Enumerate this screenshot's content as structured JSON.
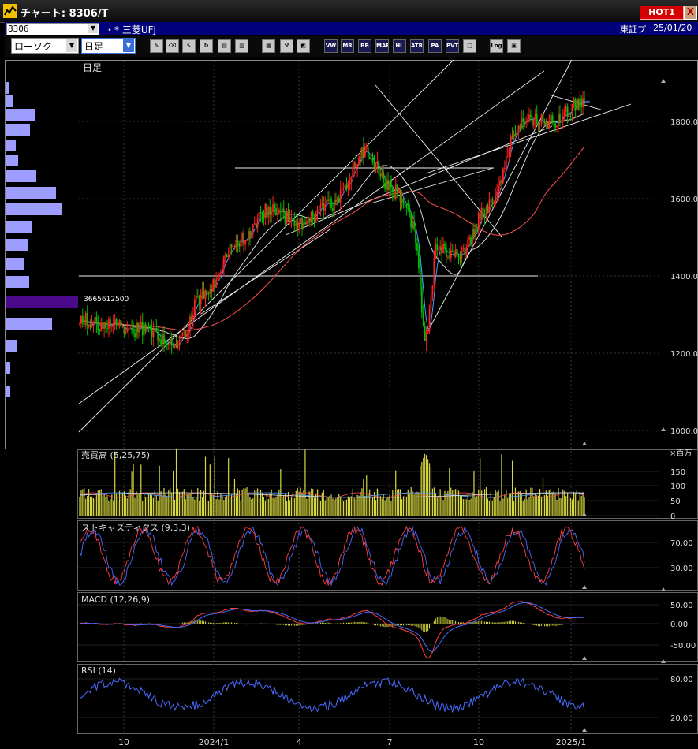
{
  "window": {
    "title": "チャート: 8306/T",
    "hot_label": "HOT1",
    "close_label": "X"
  },
  "info": {
    "code": "8306",
    "name": "・* 三菱UFJ",
    "market": "東証プ",
    "date": "25/01/20"
  },
  "toolbar": {
    "chart_type": "ローソク",
    "period": "日足"
  },
  "main_panel": {
    "label": "日足",
    "price_label_box": "3665612500",
    "y_ticks": [
      "1800.0",
      "1600.0",
      "1400.0",
      "1200.0",
      "1000.0"
    ]
  },
  "volume_panel": {
    "label": "売買高 (5,25,75)",
    "unit": "×百万",
    "y_ticks": [
      "150",
      "100",
      "50",
      "0"
    ]
  },
  "stoch_panel": {
    "label": "ストキャスティクス (9,3,3)",
    "y_ticks": [
      "70.00",
      "30.00"
    ]
  },
  "macd_panel": {
    "label": "MACD (12,26,9)",
    "y_ticks": [
      "50.00",
      "0.00",
      "-50.00"
    ]
  },
  "rsi_panel": {
    "label": "RSI (14)",
    "y_ticks": [
      "80.00",
      "20.00"
    ]
  },
  "x_axis": {
    "labels": [
      "10",
      "2024/1",
      "4",
      "7",
      "10",
      "2025/1"
    ]
  },
  "chart_data": {
    "type": "candlestick",
    "symbol": "8306",
    "timeframe": "daily",
    "ylim": [
      1000,
      1900
    ],
    "monthly_close": [
      {
        "x": "2023-09",
        "y": 1290
      },
      {
        "x": "2023-10",
        "y": 1270
      },
      {
        "x": "2023-11",
        "y": 1260
      },
      {
        "x": "2023-12",
        "y": 1215
      },
      {
        "x": "2024-01",
        "y": 1360
      },
      {
        "x": "2024-02",
        "y": 1490
      },
      {
        "x": "2024-03",
        "y": 1570
      },
      {
        "x": "2024-04",
        "y": 1540
      },
      {
        "x": "2024-05",
        "y": 1580
      },
      {
        "x": "2024-06",
        "y": 1720
      },
      {
        "x": "2024-07",
        "y": 1620
      },
      {
        "x": "2024-08",
        "y": 1470
      },
      {
        "x": "2024-09",
        "y": 1460
      },
      {
        "x": "2024-10",
        "y": 1580
      },
      {
        "x": "2024-11",
        "y": 1800
      },
      {
        "x": "2024-12",
        "y": 1800
      },
      {
        "x": "2025-01",
        "y": 1850
      }
    ],
    "horizontal_levels": [
      1640,
      1350
    ],
    "volume_profile_label": "3665612500",
    "indicators": [
      "売買高 (5,25,75)",
      "ストキャスティクス (9,3,3)",
      "MACD (12,26,9)",
      "RSI (14)"
    ]
  }
}
